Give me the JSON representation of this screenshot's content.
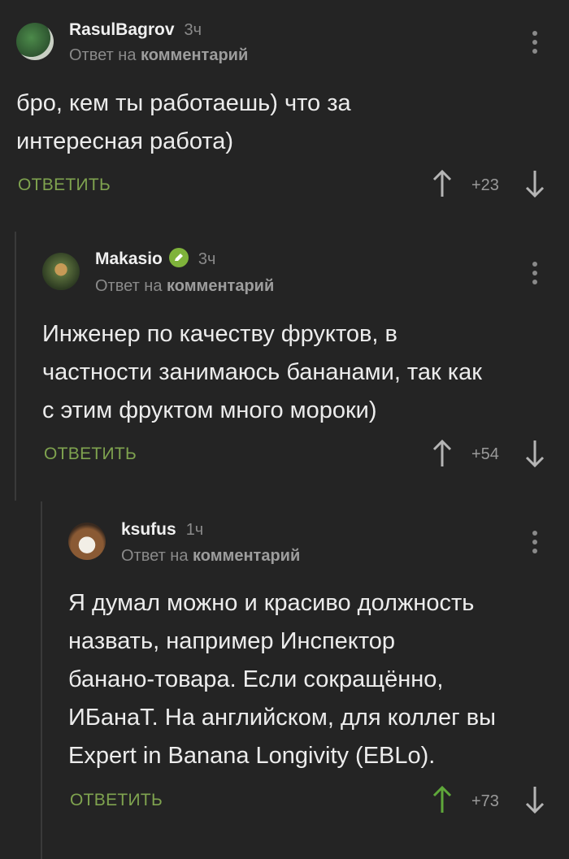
{
  "comments": [
    {
      "author": "RasulBagrov",
      "time": "3ч",
      "reply_prefix": "Ответ на",
      "reply_target": "комментарий",
      "text_lines": [
        "бро, кем ты работаешь) что за",
        "интересная работа)"
      ],
      "reply_label": "ОТВЕТИТЬ",
      "score": "+23",
      "upvoted": false,
      "verified": false
    },
    {
      "author": "Makasio",
      "time": "3ч",
      "reply_prefix": "Ответ на",
      "reply_target": "комментарий",
      "text_lines": [
        "Инженер по качеству фруктов, в",
        "частности занимаюсь бананами, так как",
        "с этим фруктом много мороки)"
      ],
      "reply_label": "ОТВЕТИТЬ",
      "score": "+54",
      "upvoted": false,
      "verified": true
    },
    {
      "author": "ksufus",
      "time": "1ч",
      "reply_prefix": "Ответ на",
      "reply_target": "комментарий",
      "text_lines": [
        "Я думал можно и красиво должность",
        "назвать, например Инспектор",
        "банано-товара. Если сокращённо,",
        "ИБанаТ. На английском, для коллег вы",
        "Expert in Banana Longivity (EBLo)."
      ],
      "reply_label": "ОТВЕТИТЬ",
      "score": "+73",
      "upvoted": true,
      "verified": false
    }
  ],
  "colors": {
    "background": "#242424",
    "accent_green": "#7fa34f",
    "upvote_active": "#5fa83a",
    "muted": "#8a8a8a"
  }
}
